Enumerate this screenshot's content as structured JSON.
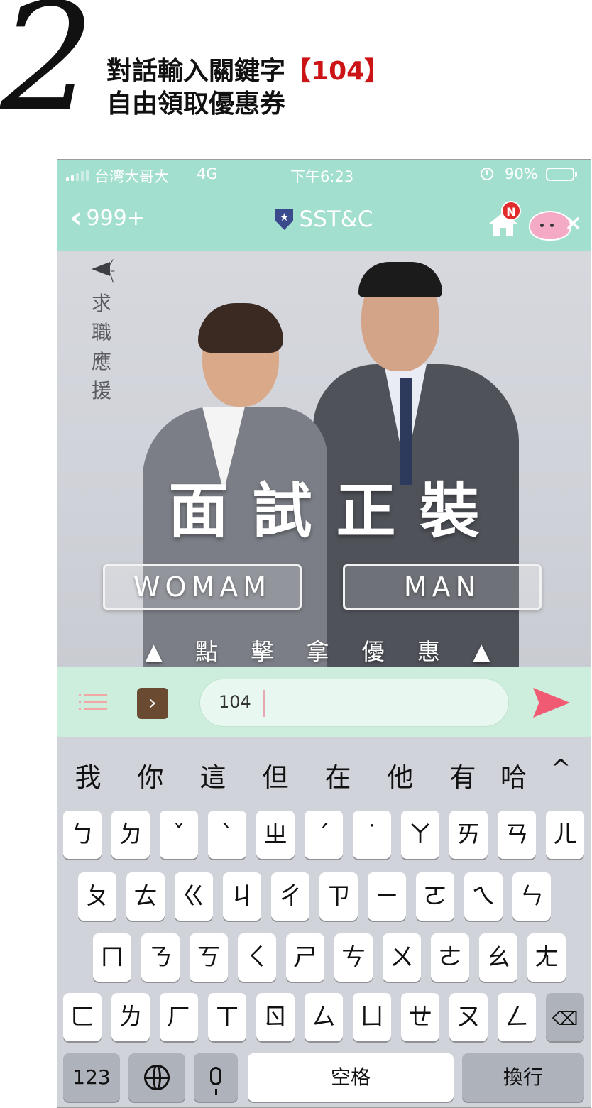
{
  "header": {
    "step_number": "2",
    "line1_prefix": "對話輸入關鍵字",
    "line1_highlight": "【104】",
    "line2": "自由領取優惠券",
    "highlight_color": "#cc1417"
  },
  "statusbar": {
    "carrier": "台湾大哥大",
    "network": "4G",
    "time": "下午6:23",
    "battery": "90%",
    "icons": [
      "signal-icon",
      "alarm-icon",
      "battery-icon"
    ]
  },
  "navbar": {
    "back_label": "999+",
    "title": "SST&C",
    "badge": "N",
    "icons": [
      "back-chevron-icon",
      "shield-icon",
      "home-icon",
      "mascot-sticker-icon"
    ]
  },
  "banner": {
    "side_text": [
      "求",
      "職",
      "應",
      "援"
    ],
    "headline": "面試正裝",
    "woman_button": "WOMAM",
    "man_button": "MAN",
    "claim_text": "▲ 點 擊 拿 優 惠 ▲"
  },
  "input_bar": {
    "message_text": "104",
    "icons": [
      "menu-icon",
      "expand-arrow-icon",
      "sticker-icon",
      "send-icon"
    ],
    "accent": "#f05a73"
  },
  "keyboard": {
    "candidates": [
      "我",
      "你",
      "這",
      "但",
      "在",
      "他",
      "有",
      "哈"
    ],
    "candidate_expand": "^",
    "row1": [
      "ㄅ",
      "ㄉ",
      "ˇ",
      "ˋ",
      "ㄓ",
      "ˊ",
      "˙",
      "ㄚ",
      "ㄞ",
      "ㄢ",
      "ㄦ"
    ],
    "row2": [
      "ㄆ",
      "ㄊ",
      "ㄍ",
      "ㄐ",
      "ㄔ",
      "ㄗ",
      "ㄧ",
      "ㄛ",
      "ㄟ",
      "ㄣ"
    ],
    "row3": [
      "ㄇ",
      "ㄋ",
      "ㄎ",
      "ㄑ",
      "ㄕ",
      "ㄘ",
      "ㄨ",
      "ㄜ",
      "ㄠ",
      "ㄤ"
    ],
    "row4": [
      "ㄈ",
      "ㄌ",
      "ㄏ",
      "ㄒ",
      "ㄖ",
      "ㄙ",
      "ㄩ",
      "ㄝ",
      "ㄡ",
      "ㄥ"
    ],
    "numbers_label": "123",
    "space_label": "空格",
    "return_label": "換行"
  }
}
